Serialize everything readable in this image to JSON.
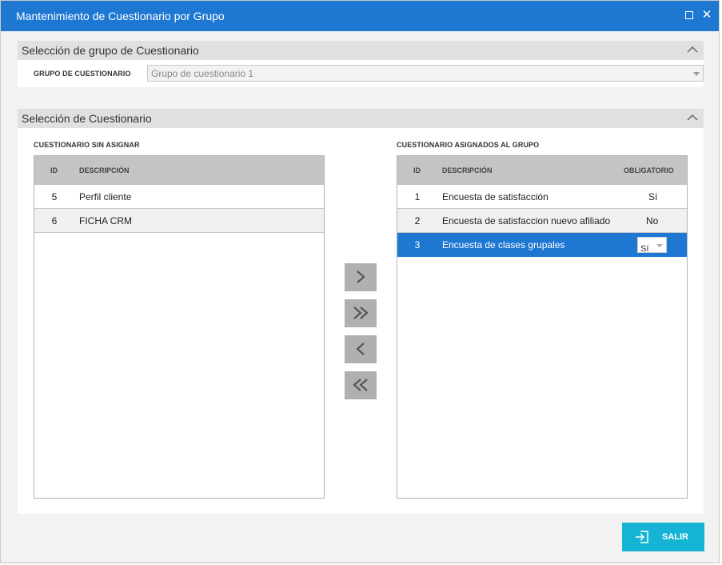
{
  "window": {
    "title": "Mantenimiento de Cuestionario por Grupo"
  },
  "group_panel": {
    "title": "Selección de grupo de Cuestionario",
    "field_label": "GRUPO DE CUESTIONARIO",
    "selected_value": "Grupo de cuestionario 1"
  },
  "questionnaire_panel": {
    "title": "Selección de Cuestionario",
    "unassigned": {
      "label": "CUESTIONARIO SIN ASIGNAR",
      "columns": {
        "id": "ID",
        "description": "DESCRIPCIÓN"
      },
      "rows": [
        {
          "id": "5",
          "description": "Perfil cliente"
        },
        {
          "id": "6",
          "description": "FICHA CRM"
        }
      ]
    },
    "assigned": {
      "label": "CUESTIONARIO ASIGNADOS AL GRUPO",
      "columns": {
        "id": "ID",
        "description": "DESCRIPCIÓN",
        "mandatory": "OBLIGATORIO"
      },
      "rows": [
        {
          "id": "1",
          "description": "Encuesta de satisfacción",
          "mandatory": "Sí"
        },
        {
          "id": "2",
          "description": "Encuesta de satisfaccion nuevo afiliado",
          "mandatory": "No"
        },
        {
          "id": "3",
          "description": "Encuesta de clases grupales",
          "mandatory": "Sí",
          "selected": true
        }
      ]
    }
  },
  "footer": {
    "exit_label": "SALIR"
  },
  "colors": {
    "titlebar": "#1e78d2",
    "selected_row": "#1e78d2",
    "exit_button": "#16b4d4",
    "move_button": "#b0b0b0"
  },
  "icons": [
    "maximize-icon",
    "close-icon",
    "chevron-up-icon",
    "chevron-down-icon",
    "move-right-icon",
    "move-all-right-icon",
    "move-left-icon",
    "move-all-left-icon",
    "exit-icon"
  ]
}
